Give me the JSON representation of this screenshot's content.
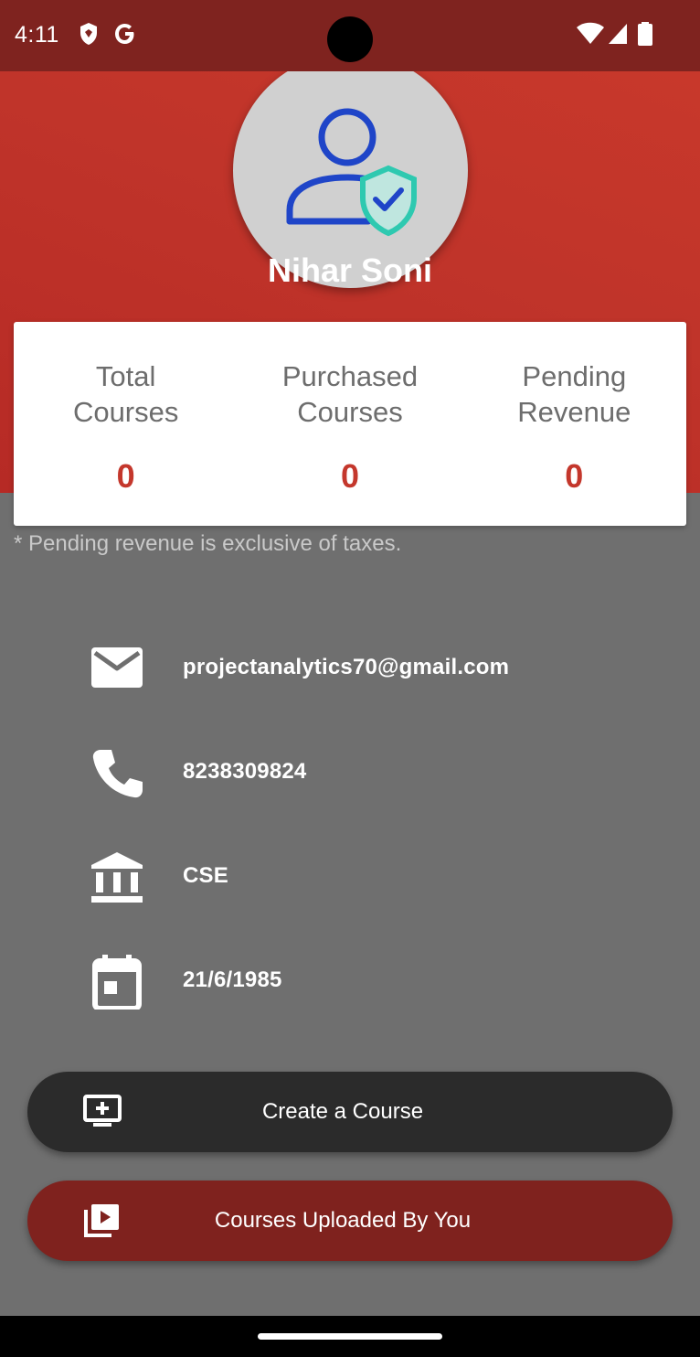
{
  "status_bar": {
    "time": "4:11",
    "icons": [
      "shield-icon",
      "google-g-icon",
      "wifi-icon",
      "signal-icon",
      "battery-icon"
    ]
  },
  "profile": {
    "name": "Nihar Soni",
    "avatar_icon": "verified-user-icon"
  },
  "stats": [
    {
      "label": "Total\nCourses",
      "value": "0"
    },
    {
      "label": "Purchased\nCourses",
      "value": "0"
    },
    {
      "label": "Pending\nRevenue",
      "value": "0"
    }
  ],
  "note": "* Pending revenue is exclusive of taxes.",
  "info": {
    "email": "projectanalytics70@gmail.com",
    "phone": "8238309824",
    "department": "CSE",
    "dob": "21/6/1985"
  },
  "buttons": {
    "create": "Create a Course",
    "uploaded": "Courses Uploaded By You"
  },
  "colors": {
    "header_red": "#c0342a",
    "status_bar": "#7f231f",
    "stat_value": "#c4372c",
    "create_button": "#2b2b2b",
    "uploaded_button": "#7f221e",
    "page_gray": "#6f6f6f"
  }
}
